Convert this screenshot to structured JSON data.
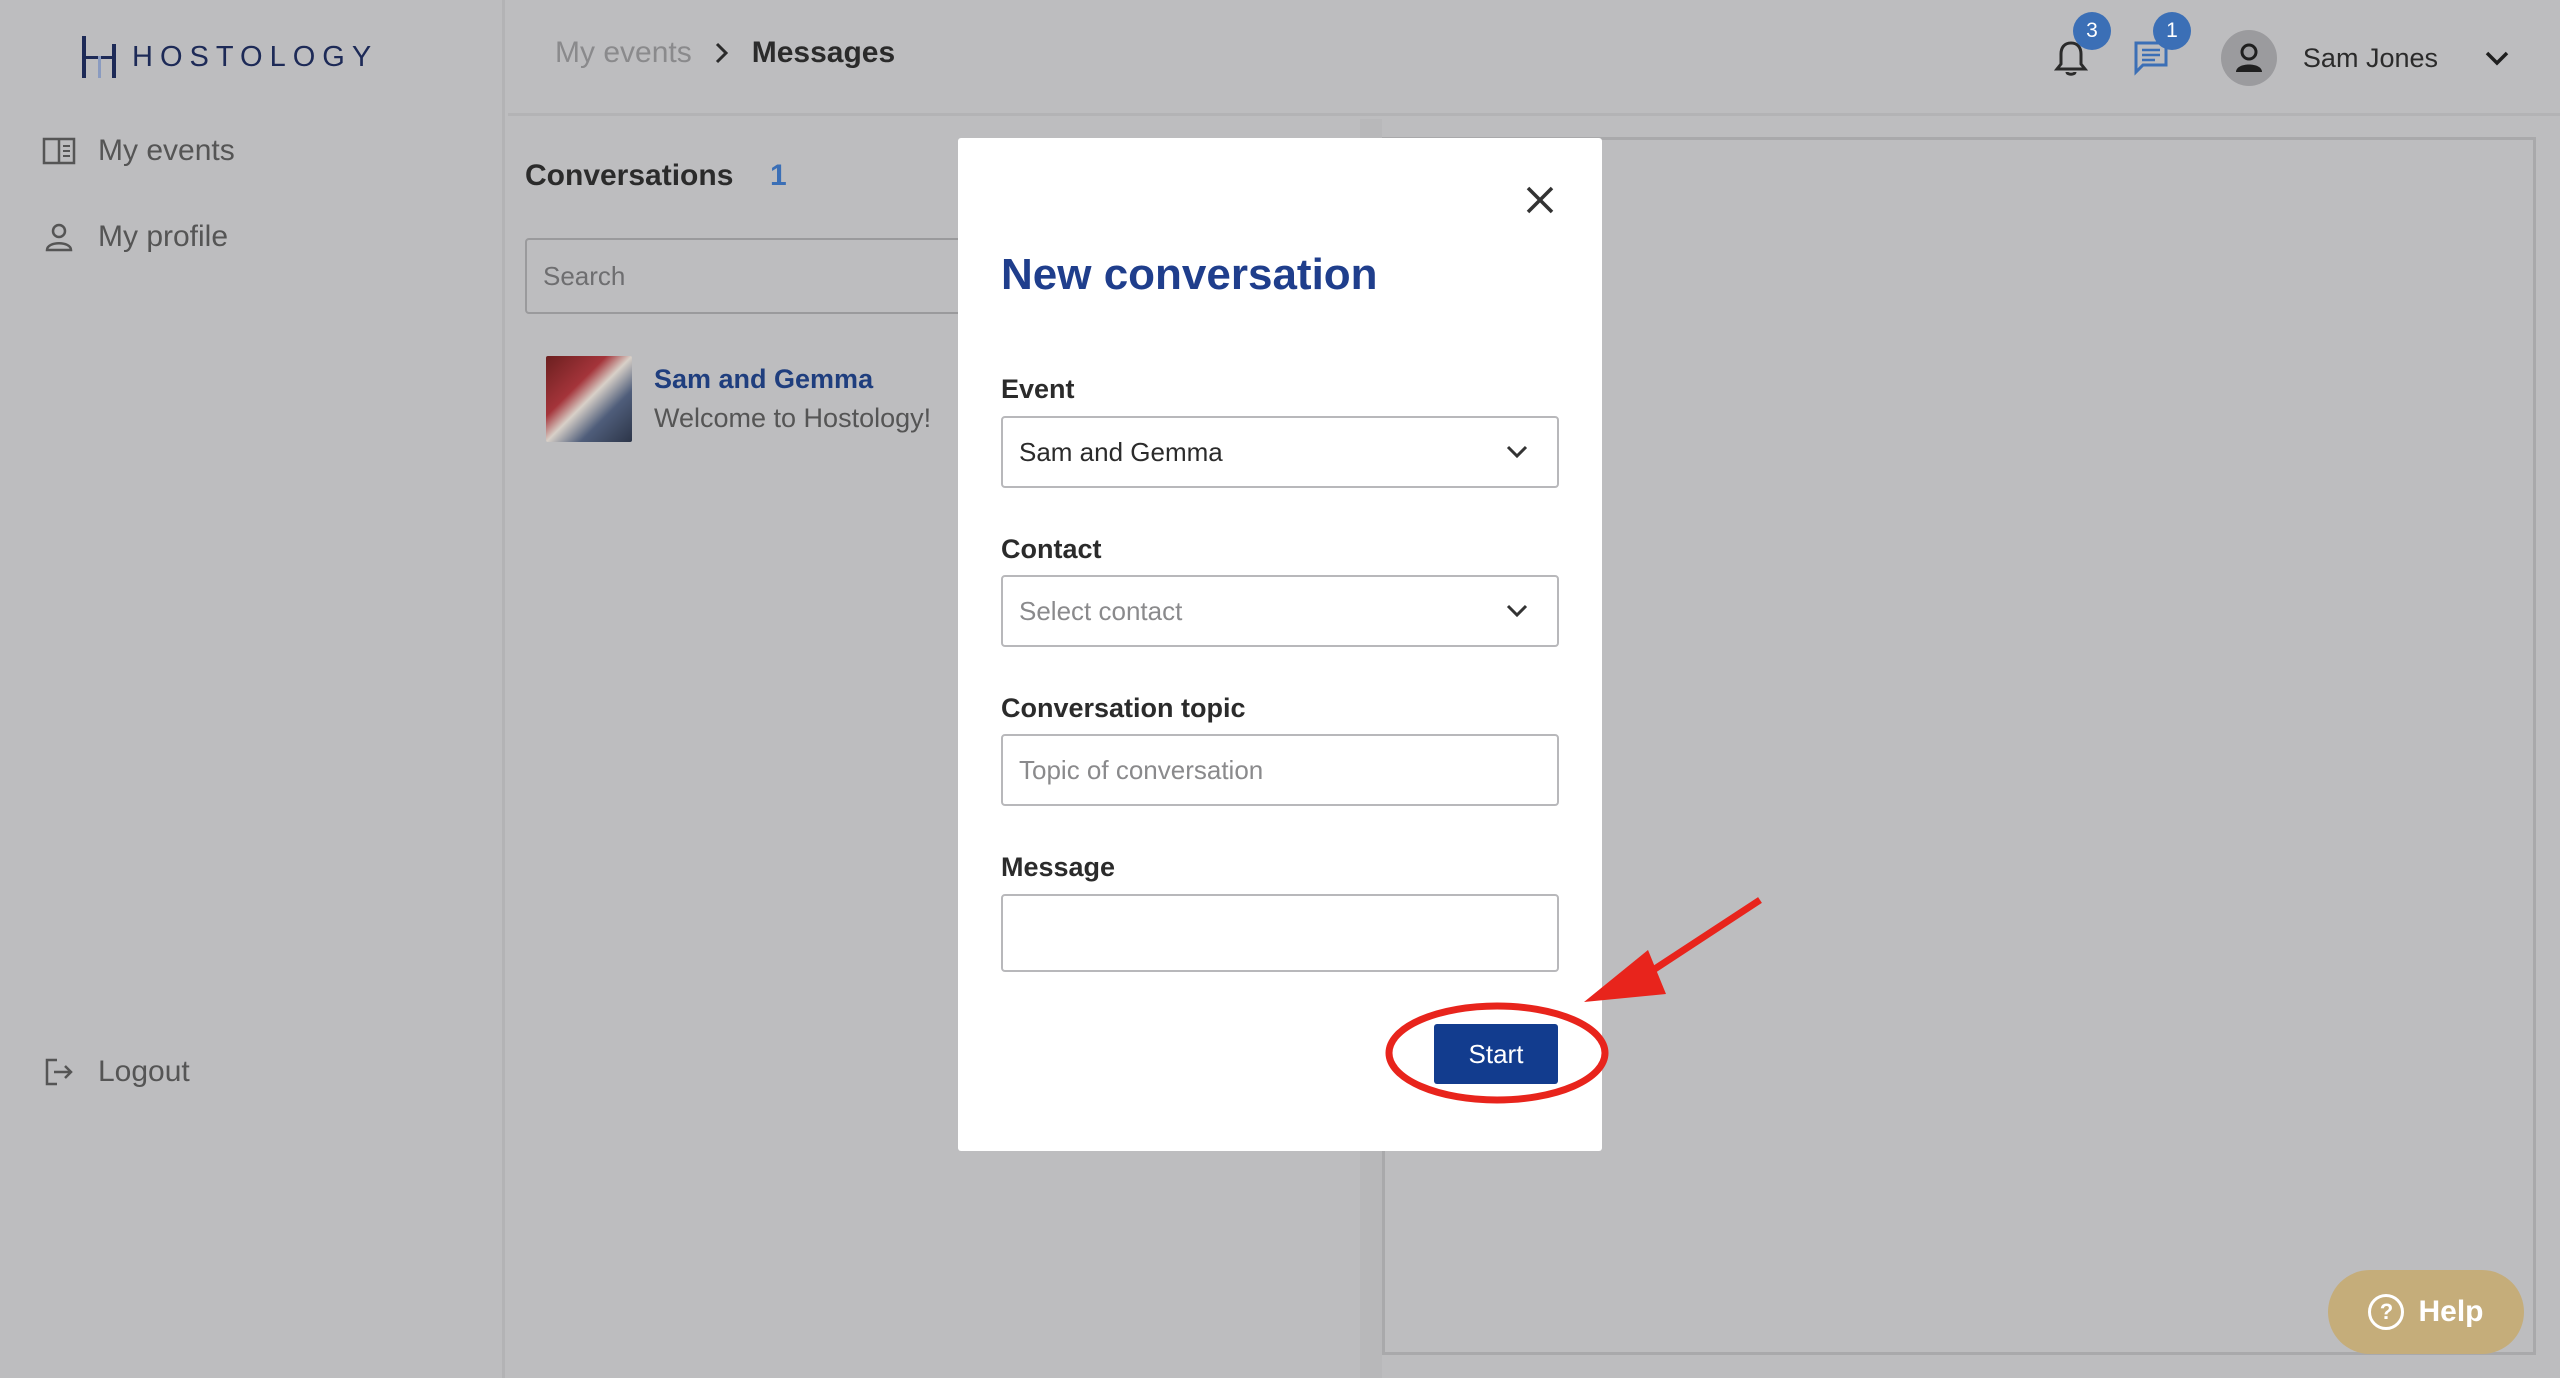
{
  "brand": {
    "name": "HOSTOLOGY"
  },
  "sidebar": {
    "items": [
      {
        "label": "My events",
        "icon": "book-icon"
      },
      {
        "label": "My profile",
        "icon": "person-icon"
      }
    ],
    "logout_label": "Logout"
  },
  "header": {
    "breadcrumb": {
      "parent": "My events",
      "current": "Messages"
    },
    "notifications_count": "3",
    "messages_count": "1",
    "user_name": "Sam Jones"
  },
  "conversations": {
    "title": "Conversations",
    "count": "1",
    "search_placeholder": "Search",
    "items": [
      {
        "name": "Sam and Gemma",
        "preview": "Welcome to Hostology!"
      }
    ]
  },
  "modal": {
    "title": "New conversation",
    "event_label": "Event",
    "event_value": "Sam and Gemma",
    "contact_label": "Contact",
    "contact_placeholder": "Select contact",
    "topic_label": "Conversation topic",
    "topic_placeholder": "Topic of conversation",
    "message_label": "Message",
    "message_value": "",
    "start_label": "Start"
  },
  "help": {
    "label": "Help"
  },
  "colors": {
    "accent": "#123c8e",
    "title_blue": "#1f3e8c",
    "badge_blue": "#3b6fb6",
    "help_gold": "#c5ad7a",
    "annotation_red": "#e8241c"
  }
}
